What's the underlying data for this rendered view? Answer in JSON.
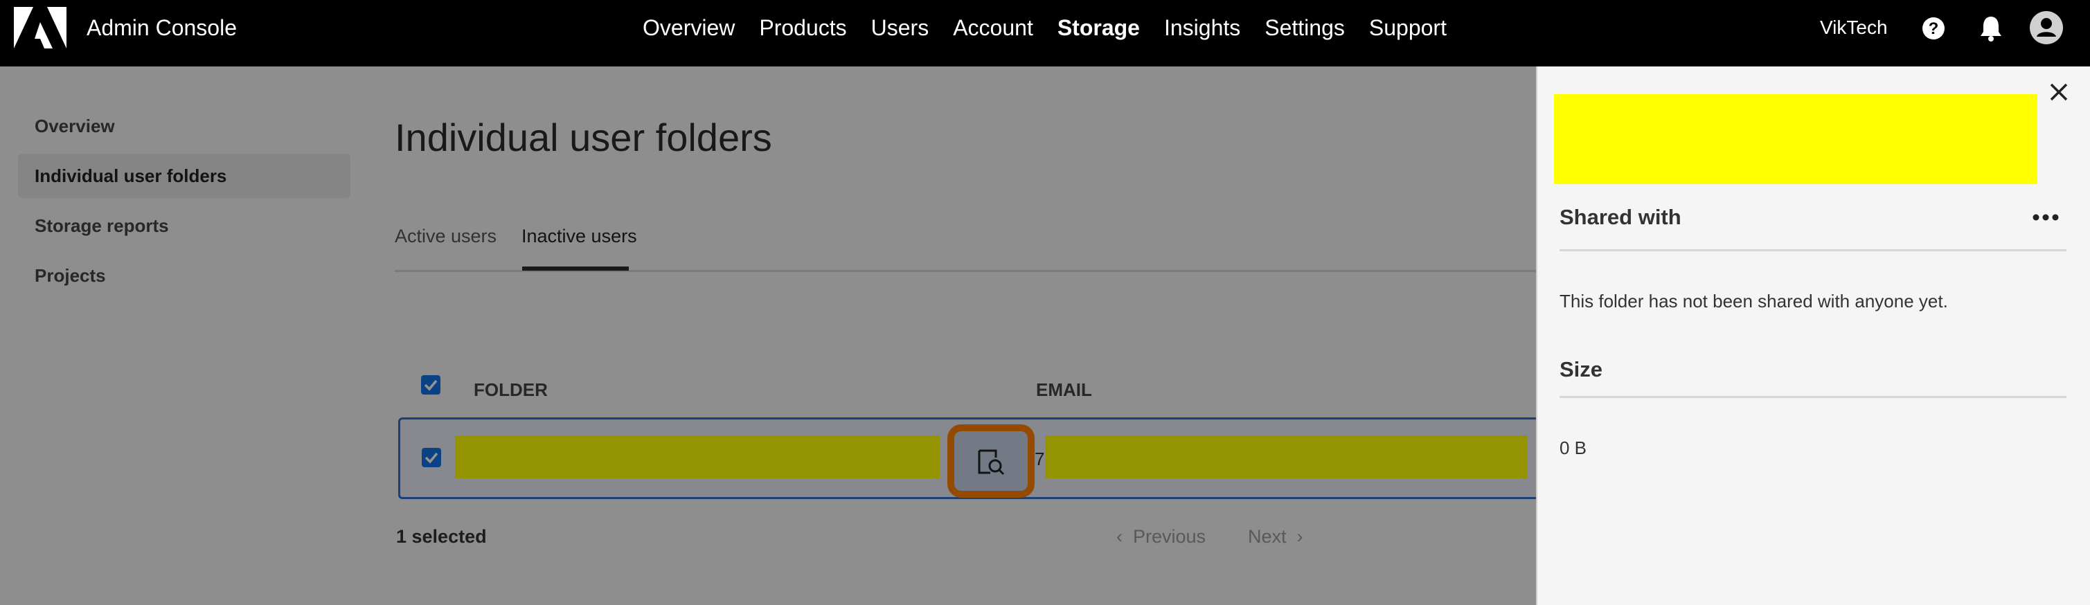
{
  "header": {
    "app_title": "Admin Console",
    "nav": [
      "Overview",
      "Products",
      "Users",
      "Account",
      "Storage",
      "Insights",
      "Settings",
      "Support"
    ],
    "active_nav": "Storage",
    "org_name": "VikTech"
  },
  "sidebar": {
    "items": [
      {
        "label": "Overview"
      },
      {
        "label": "Individual user folders"
      },
      {
        "label": "Storage reports"
      },
      {
        "label": "Projects"
      }
    ],
    "active": "Individual user folders"
  },
  "main": {
    "title": "Individual user folders",
    "tabs": [
      {
        "label": "Active users"
      },
      {
        "label": "Inactive users"
      }
    ],
    "active_tab": "Inactive users",
    "table": {
      "columns": [
        "FOLDER",
        "EMAIL"
      ],
      "rows": [
        {
          "selected": true,
          "email_fragment": "7"
        }
      ]
    },
    "selected_count": "1 selected",
    "pagination": {
      "previous": "Previous",
      "next": "Next"
    }
  },
  "panel": {
    "shared_with_heading": "Shared with",
    "shared_with_text": "This folder has not been shared with anyone yet.",
    "size_heading": "Size",
    "size_value": "0 B"
  },
  "colors": {
    "accent": "#1473e6",
    "focus_ring": "#ff8000",
    "redaction": "#ffff00",
    "topbar": "#000000"
  }
}
